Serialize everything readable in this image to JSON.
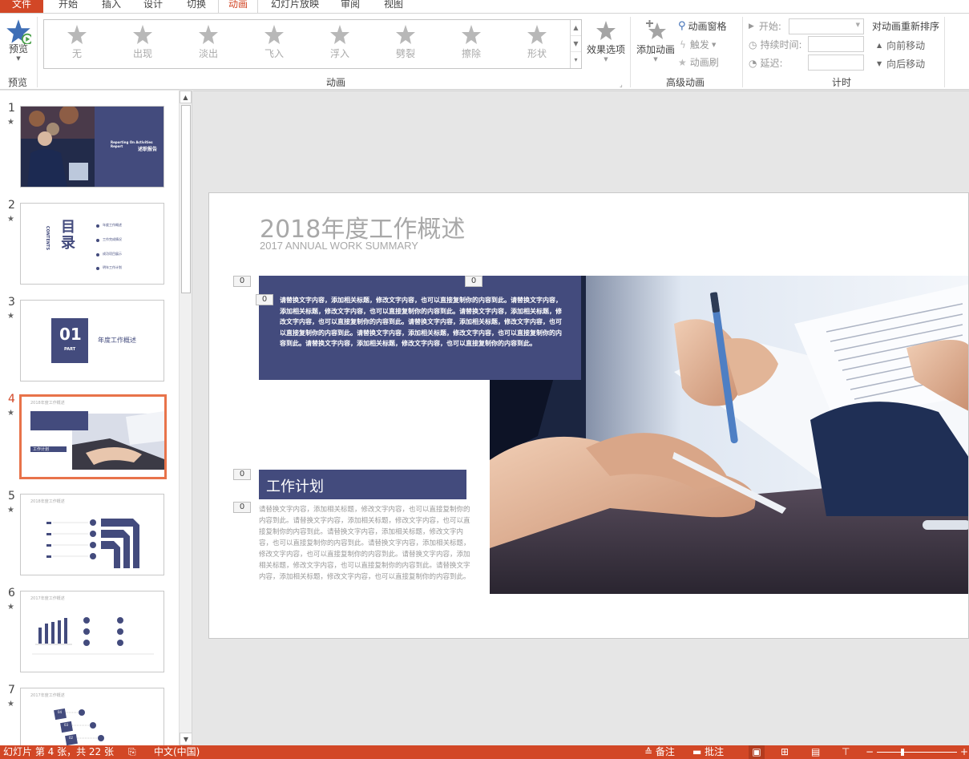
{
  "tabs": [
    "文件",
    "开始",
    "插入",
    "设计",
    "切换",
    "动画",
    "幻灯片放映",
    "审阅",
    "视图"
  ],
  "ribbon": {
    "preview_label": "预览",
    "preview_group": "预览",
    "animations_group": "动画",
    "effects": [
      "无",
      "出现",
      "淡出",
      "飞入",
      "浮入",
      "劈裂",
      "擦除",
      "形状"
    ],
    "effect_options": "效果选项",
    "add_animation": "添加动画",
    "advanced_group": "高级动画",
    "animation_pane": "动画窗格",
    "trigger": "触发",
    "animation_painter": "动画刷",
    "start_label": "开始:",
    "duration_label": "持续时间:",
    "delay_label": "延迟:",
    "timing_group": "计时",
    "reorder_title": "对动画重新排序",
    "move_earlier": "向前移动",
    "move_later": "向后移动"
  },
  "thumbnails": {
    "numbers": [
      "1",
      "2",
      "3",
      "4",
      "5",
      "6",
      "7"
    ],
    "selected": 4,
    "slide1_title_en": "Reporting On Activities Report",
    "slide1_title_cn": "述职报告",
    "slide2_title": "目录",
    "slide2_sub": "CONTENTS",
    "slide2_items": [
      "年度工作概述",
      "工作完成情况",
      "成功项目展示",
      "明年工作计划"
    ],
    "slide3_num": "01",
    "slide3_part": "PART",
    "slide3_title": "年度工作概述",
    "slide4_title": "2018年度工作概述",
    "slide4_plan": "工作计划",
    "slide5_title": "2018年度工作概述",
    "slide6_title": "2017年度工作概述",
    "slide7_title": "2017年度工作概述",
    "slide7_steps": [
      "04",
      "03",
      "02"
    ]
  },
  "slide": {
    "title": "2018年度工作概述",
    "subtitle": "2017 ANNUAL WORK SUMMARY",
    "box_text": "请替换文字内容，添加相关标题，修改文字内容，也可以直接复制你的内容到此。请替换文字内容，添加相关标题，修改文字内容，也可以直接复制你的内容到此。请替换文字内容，添加相关标题，修改文字内容，也可以直接复制你的内容到此。请替换文字内容，添加相关标题，修改文字内容，也可以直接复制你的内容到此。请替换文字内容，添加相关标题，修改文字内容，也可以直接复制你的内容到此。请替换文字内容，添加相关标题，修改文字内容，也可以直接复制你的内容到此。",
    "plan_title": "工作计划",
    "plan_text": "请替换文字内容，添加相关标题，修改文字内容，也可以直接复制你的内容到此。请替换文字内容，添加相关标题，修改文字内容，也可以直接复制你的内容到此。请替换文字内容，添加相关标题，修改文字内容，也可以直接复制你的内容到此。请替换文字内容，添加相关标题，修改文字内容，也可以直接复制你的内容到此。请替换文字内容，添加相关标题，修改文字内容，也可以直接复制你的内容到此。请替换文字内容，添加相关标题，修改文字内容，也可以直接复制你的内容到此。",
    "anim_tag": "0"
  },
  "status": {
    "slide_info": "幻灯片 第 4 张，共 22 张",
    "language": "中文(中国)",
    "notes": "备注",
    "comments": "批注"
  },
  "colors": {
    "accent": "#d24726",
    "navy": "#434b7d",
    "thumb_select": "#e8734a"
  }
}
